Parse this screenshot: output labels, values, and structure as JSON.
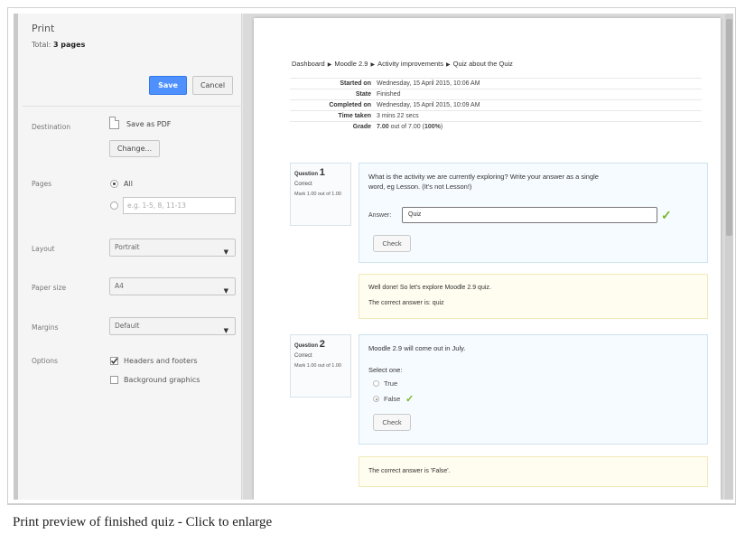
{
  "print_panel": {
    "title": "Print",
    "total_label": "Total:",
    "total_value": "3 pages",
    "save_label": "Save",
    "cancel_label": "Cancel",
    "destination_label": "Destination",
    "destination_value": "Save as PDF",
    "change_label": "Change...",
    "pages_label": "Pages",
    "pages_all_label": "All",
    "pages_range_placeholder": "e.g. 1-5, 8, 11-13",
    "layout_label": "Layout",
    "layout_value": "Portrait",
    "paper_size_label": "Paper size",
    "paper_size_value": "A4",
    "margins_label": "Margins",
    "margins_value": "Default",
    "options_label": "Options",
    "option_headers_footers": "Headers and footers",
    "option_headers_footers_checked": true,
    "option_background_graphics": "Background graphics",
    "option_background_graphics_checked": false
  },
  "preview": {
    "breadcrumb": [
      "Dashboard",
      "Moodle 2.9",
      "Activity improvements",
      "Quiz about the Quiz"
    ],
    "summary": [
      {
        "key": "Started on",
        "value": "Wednesday, 15 April 2015, 10:06 AM"
      },
      {
        "key": "State",
        "value": "Finished"
      },
      {
        "key": "Completed on",
        "value": "Wednesday, 15 April 2015, 10:09 AM"
      },
      {
        "key": "Time taken",
        "value": "3 mins 22 secs"
      },
      {
        "key": "Grade",
        "value_bold": "7.00",
        "value_mid": " out of 7.00 (",
        "value_pct": "100%",
        "value_end": ")"
      }
    ],
    "q1": {
      "label": "Question",
      "number": "1",
      "status": "Correct",
      "mark": "Mark 1.00 out of 1.00",
      "text_line1": "What is the activity we are currently exploring? Write your answer as a single",
      "text_line2": "word, eg Lesson. (It's not Lesson!)",
      "answer_label": "Answer:",
      "answer_value": "Quiz",
      "check_label": "Check",
      "feedback": "Well done! So let's explore Moodle 2.9 quiz.",
      "correct_answer": "The correct answer is: quiz"
    },
    "q2": {
      "label": "Question",
      "number": "2",
      "status": "Correct",
      "mark": "Mark 1.00 out of 1.00",
      "text": "Moodle 2.9 will come out in July.",
      "select_one": "Select one:",
      "option_true": "True",
      "option_false": "False",
      "selected": "False",
      "check_label": "Check",
      "correct_answer": "The correct answer is 'False'."
    }
  },
  "caption": "Print preview of finished quiz - Click to enlarge",
  "colors": {
    "save_button": "#4d90fe",
    "correct_tick": "#76b82a",
    "question_box_border": "#cfe3ef",
    "feedback_box_border": "#f0eaba"
  },
  "icons": {
    "destination": "pdf-file-icon",
    "breadcrumb_separator": "triangle-right-icon",
    "dropdown": "caret-down-icon",
    "correct": "check-mark-icon"
  }
}
